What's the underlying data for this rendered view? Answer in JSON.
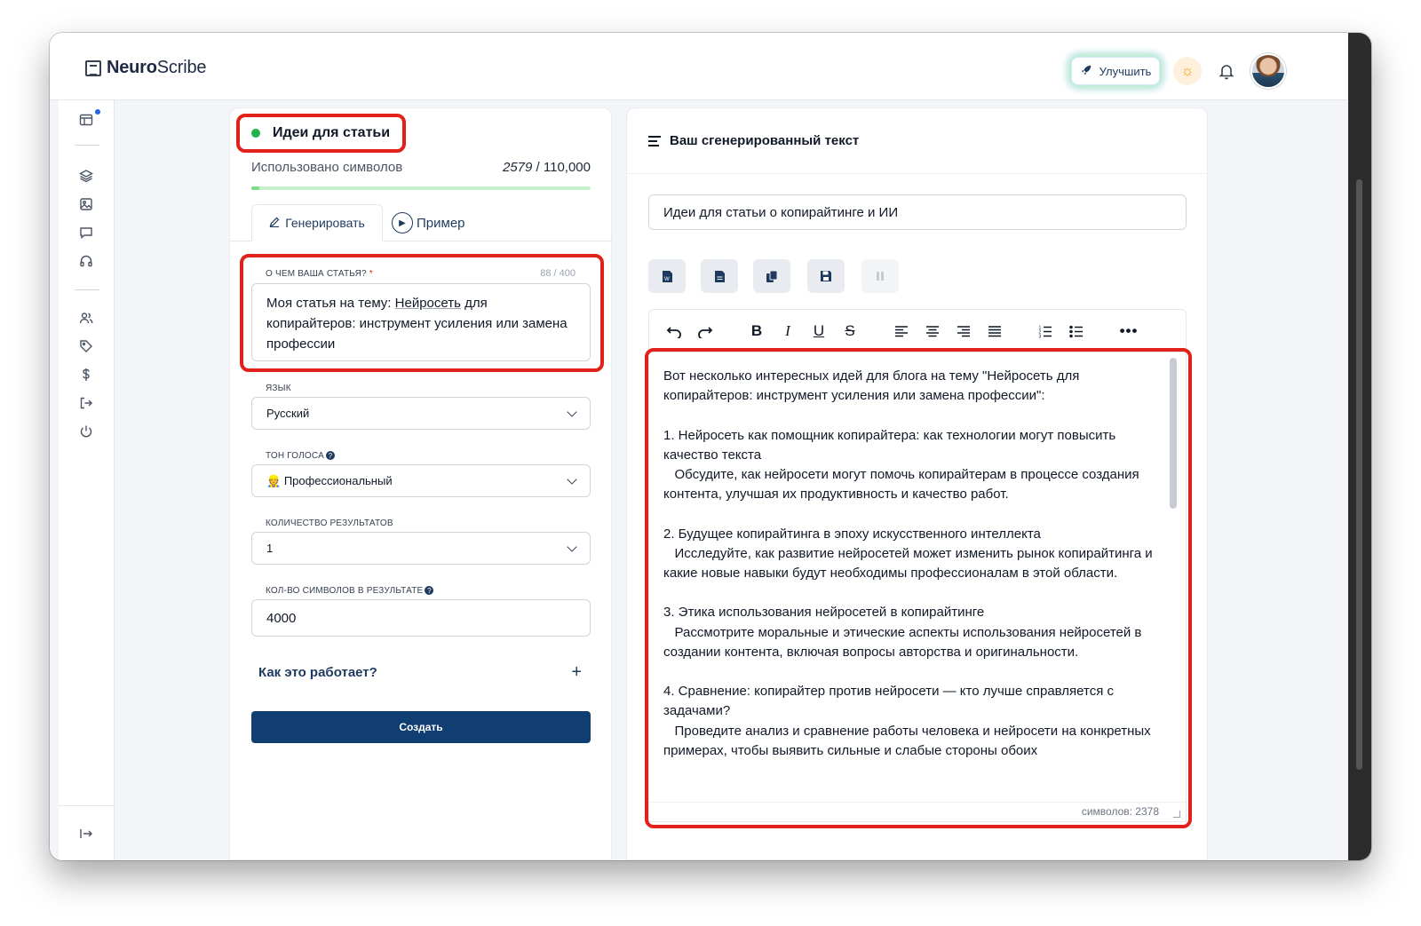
{
  "app": {
    "logo_bold": "Neuro",
    "logo_light": "Scribe",
    "upgrade_label": "Улучшить"
  },
  "sidebar": {
    "icons": [
      "grid-icon",
      "layers-icon",
      "image-icon",
      "chat-icon",
      "headphones-icon",
      "users-icon",
      "tag-icon",
      "dollar-icon",
      "logout-icon",
      "power-icon"
    ],
    "collapse_icon": "collapse-arrow-icon"
  },
  "left": {
    "title": "Идеи для статьи",
    "usage_label": "Использовано символов",
    "usage_used": "2579",
    "usage_total": "/ 110,000",
    "usage_fraction": 0.0234,
    "tab_generate": "Генерировать",
    "tab_example": "Пример",
    "topic_label": "О ЧЕМ ВАША СТАТЬЯ?",
    "topic_required": "*",
    "topic_counter": "88 / 400",
    "topic_value_prefix": "Моя статья на тему: ",
    "topic_value_underlined": "Нейросеть",
    "topic_value_rest": " для копирайтеров: инструмент усиления или замена профессии",
    "language_label": "ЯЗЫК",
    "language_value": "Русский",
    "tone_label": "ТОН ГОЛОСА",
    "tone_emoji": "👷",
    "tone_value": "Профессиональный",
    "results_label": "КОЛИЧЕСТВО РЕЗУЛЬТАТОВ",
    "results_value": "1",
    "chars_label": "КОЛ-ВО СИМВОЛОВ В РЕЗУЛЬТАТЕ",
    "chars_value": "4000",
    "how_label": "Как это работает?",
    "how_plus": "+",
    "create_label": "Создать"
  },
  "right": {
    "header_title": "Ваш сгенерированный текст",
    "doc_title": "Идеи для статьи о копирайтинге и ИИ",
    "editor_text": "Вот несколько интересных идей для блога на тему \"Нейросеть для копирайтеров: инструмент усиления или замена профессии\":\n\n1. Нейросеть как помощник копирайтера: как технологии могут повысить качество текста\n   Обсудите, как нейросети могут помочь копирайтерам в процессе создания контента, улучшая их продуктивность и качество работ.\n\n2. Будущее копирайтинга в эпоху искусственного интеллекта\n   Исследуйте, как развитие нейросетей может изменить рынок копирайтинга и какие новые навыки будут необходимы профессионалам в этой области.\n\n3. Этика использования нейросетей в копирайтинге\n   Рассмотрите моральные и этические аспекты использования нейросетей в создании контента, включая вопросы авторства и оригинальности.\n\n4. Сравнение: копирайтер против нейросети — кто лучше справляется с задачами?\n   Проведите анализ и сравнение работы человека и нейросети на конкретных примерах, чтобы выявить сильные и слабые стороны обоих",
    "char_count": "символов: 2378"
  },
  "colors": {
    "primary": "#103e72",
    "highlight": "#e0221b",
    "status": "#20b14a"
  }
}
